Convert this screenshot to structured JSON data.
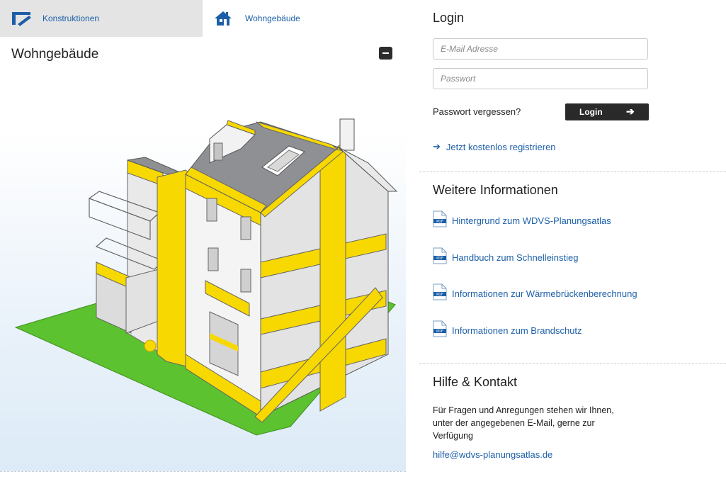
{
  "tabs": [
    {
      "label": "Konstruktionen",
      "icon": "pencil-ruler-icon",
      "active": true
    },
    {
      "label": "Wohngebäude",
      "icon": "house-icon",
      "active": false
    }
  ],
  "stage": {
    "title": "Wohngebäude",
    "collapse_icon": "minus-icon"
  },
  "login": {
    "title": "Login",
    "email_placeholder": "E-Mail Adresse",
    "password_placeholder": "Passwort",
    "forgot_label": "Passwort vergessen?",
    "button_label": "Login",
    "button_arrow": "➔",
    "register_arrow": "➔",
    "register_label": "Jetzt kostenlos registrieren"
  },
  "info": {
    "title": "Weitere Informationen",
    "icon": "pdf-icon",
    "links": [
      "Hintergrund zum WDVS-Planungsatlas",
      "Handbuch zum Schnelleinstieg",
      "Informationen zur Wärmebrückenberechnung",
      "Informationen zum Brandschutz"
    ]
  },
  "help": {
    "title": "Hilfe & Kontakt",
    "text_lines": [
      "Für Fragen und Anregungen stehen wir Ihnen,",
      "unter der angegebenen E-Mail, gerne zur",
      "Verfügung"
    ],
    "email": "hilfe@wdvs-planungsatlas.de"
  },
  "colors": {
    "accent_yellow": "#f7d800",
    "link_blue": "#1c5fa8",
    "lawn_green": "#5cc22f",
    "roof_grey": "#8e9094"
  }
}
